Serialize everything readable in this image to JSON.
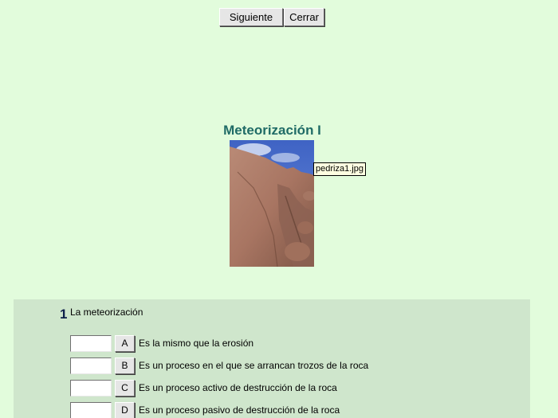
{
  "toolbar": {
    "next_label": "Siguiente",
    "close_label": "Cerrar"
  },
  "lesson": {
    "title": "Meteorización I",
    "image_tooltip": "pedriza1.jpg",
    "image_alt": "pedriza1.jpg"
  },
  "question": {
    "number": "1",
    "text": "La meteorización",
    "answers": [
      {
        "letter": "A",
        "text": "Es la mismo que la erosión",
        "value": ""
      },
      {
        "letter": "B",
        "text": "Es un proceso en el que se arrancan trozos de la roca",
        "value": ""
      },
      {
        "letter": "C",
        "text": "Es un proceso activo de destrucción de la roca",
        "value": ""
      },
      {
        "letter": "D",
        "text": "Es un proceso pasivo de destrucción de la roca",
        "value": ""
      }
    ]
  },
  "colors": {
    "background": "#e2fcdc",
    "panel": "#cfe6cc",
    "title": "#1f6b66",
    "question_number": "#0d1f4a"
  }
}
